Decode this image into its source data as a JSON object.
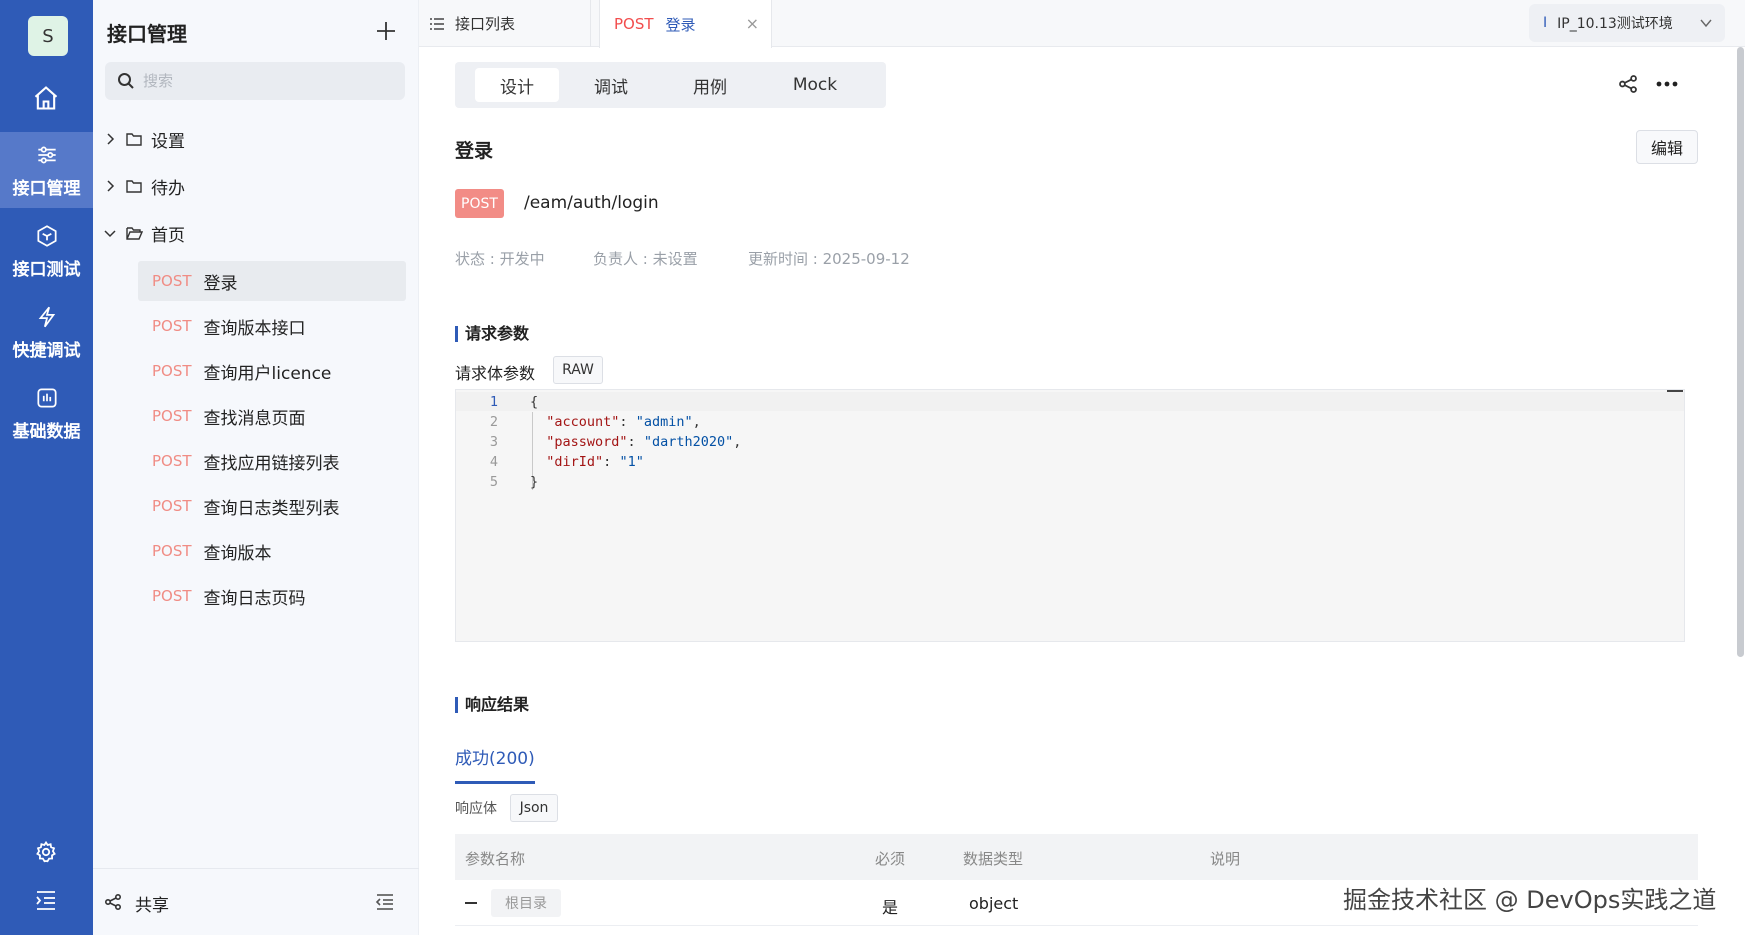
{
  "rail": {
    "avatar": "S",
    "items": [
      {
        "label": "接口管理",
        "icon": "sliders-icon"
      },
      {
        "label": "接口测试",
        "icon": "cube-icon"
      },
      {
        "label": "快捷调试",
        "icon": "lightning-icon"
      },
      {
        "label": "基础数据",
        "icon": "chart-icon"
      }
    ],
    "home_icon": "home-icon",
    "settings_icon": "gear-icon",
    "menu_icon": "menu-indent-icon"
  },
  "tree": {
    "title": "接口管理",
    "search_placeholder": "搜索",
    "folders": [
      {
        "label": "设置",
        "expanded": false
      },
      {
        "label": "待办",
        "expanded": false
      },
      {
        "label": "首页",
        "expanded": true
      }
    ],
    "apis": [
      {
        "method": "POST",
        "name": "登录"
      },
      {
        "method": "POST",
        "name": "查询版本接口"
      },
      {
        "method": "POST",
        "name": "查询用户licence"
      },
      {
        "method": "POST",
        "name": "查找消息页面"
      },
      {
        "method": "POST",
        "name": "查找应用链接列表"
      },
      {
        "method": "POST",
        "name": "查询日志类型列表"
      },
      {
        "method": "POST",
        "name": "查询版本"
      },
      {
        "method": "POST",
        "name": "查询日志页码"
      }
    ],
    "footer_share": "共享"
  },
  "tabs": {
    "list_tab": "接口列表",
    "active_tab_method": "POST",
    "active_tab_name": "登录",
    "close": "×",
    "env": "IP_10.13测试环境",
    "env_marker": "I"
  },
  "main": {
    "segments": [
      "设计",
      "调试",
      "用例",
      "Mock"
    ],
    "title": "登录",
    "edit": "编辑",
    "method": "POST",
    "path": "/eam/auth/login",
    "status": "状态 : 开发中",
    "owner": "负责人 : 未设置",
    "updated": "更新时间 : 2025-09-12",
    "request_section": "请求参数",
    "body_label": "请求体参数",
    "body_type": "RAW",
    "code_line_numbers": [
      "1",
      "2",
      "3",
      "4",
      "5"
    ],
    "code": {
      "open": "{",
      "close": "}",
      "fields": [
        {
          "key": "\"account\"",
          "value": "\"admin\"",
          "trail": ","
        },
        {
          "key": "\"password\"",
          "value": "\"darth2020\"",
          "trail": ","
        },
        {
          "key": "\"dirId\"",
          "value": "\"1\"",
          "trail": ""
        }
      ]
    },
    "response_section": "响应结果",
    "response_tab": "成功(200)",
    "response_body_label": "响应体",
    "response_body_type": "Json",
    "table_headers": [
      "参数名称",
      "必须",
      "数据类型",
      "说明"
    ],
    "table_rows": [
      {
        "name": "根目录",
        "required": "是",
        "type": "object",
        "desc": ""
      }
    ]
  },
  "watermark": "掘金技术社区 @ DevOps实践之道",
  "colors": {
    "brand": "#2f5bb7",
    "post": "#f28c86"
  }
}
